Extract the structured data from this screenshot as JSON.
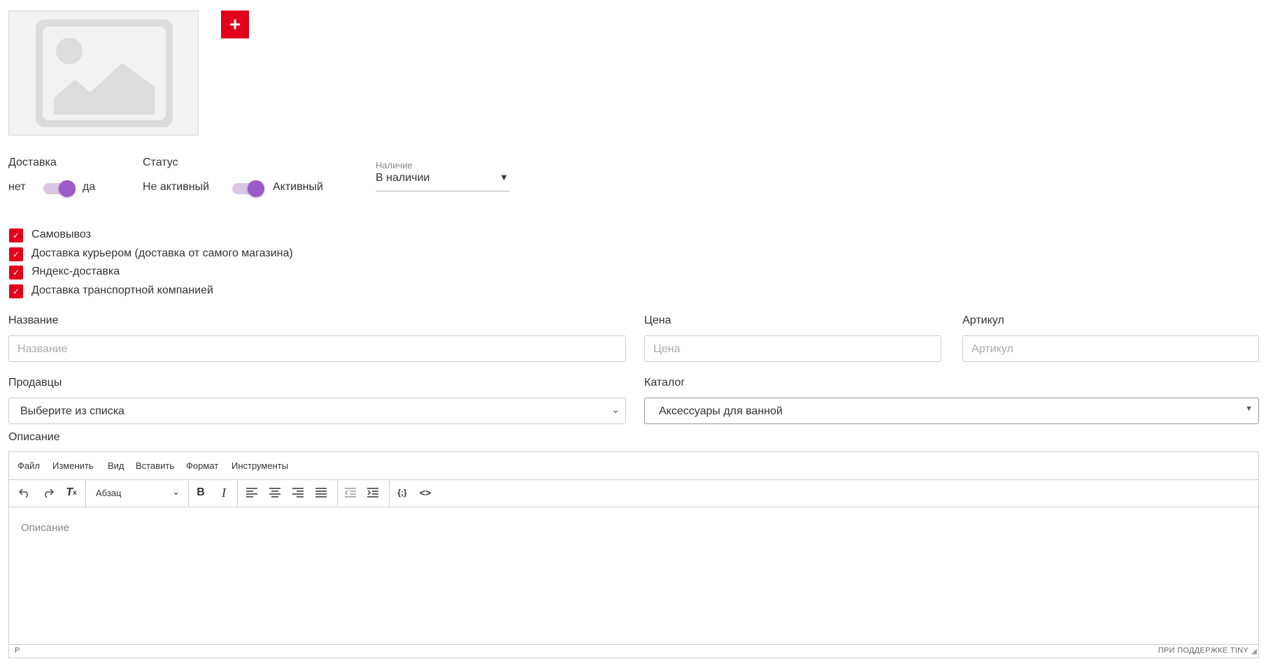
{
  "image": {
    "add_button_label": "+"
  },
  "delivery": {
    "label": "Доставка",
    "off_label": "нет",
    "on_label": "да"
  },
  "status": {
    "label": "Статус",
    "off_label": "Не активный",
    "on_label": "Активный"
  },
  "availability": {
    "label": "Наличие",
    "value": "В наличии",
    "arrow": "▼"
  },
  "shipping_options": [
    {
      "label": "Самовывоз",
      "checked": true
    },
    {
      "label": "Доставка курьером (доставка от самого магазина)",
      "checked": true
    },
    {
      "label": "Яндекс-доставка",
      "checked": true
    },
    {
      "label": "Доставка транспортной компанией",
      "checked": true
    }
  ],
  "fields": {
    "name": {
      "label": "Название",
      "placeholder": "Название"
    },
    "price": {
      "label": "Цена",
      "placeholder": "Цена"
    },
    "sku": {
      "label": "Артикул",
      "placeholder": "Артикул"
    },
    "sellers": {
      "label": "Продавцы",
      "value": "Выберите из списка"
    },
    "catalog": {
      "label": "Каталог",
      "value": "Аксессуары для ванной"
    }
  },
  "description": {
    "label": "Описание",
    "menu": [
      "Файл",
      "Изменить",
      "Вид",
      "Вставить",
      "Формат",
      "Инструменты"
    ],
    "block_format": "Абзац",
    "placeholder": "Описание",
    "status_path": "P",
    "powered_by": "ПРИ ПОДДЕРЖКЕ TINY"
  },
  "colors": {
    "accent": "#e2001a",
    "toggle": "#9b59c9"
  }
}
